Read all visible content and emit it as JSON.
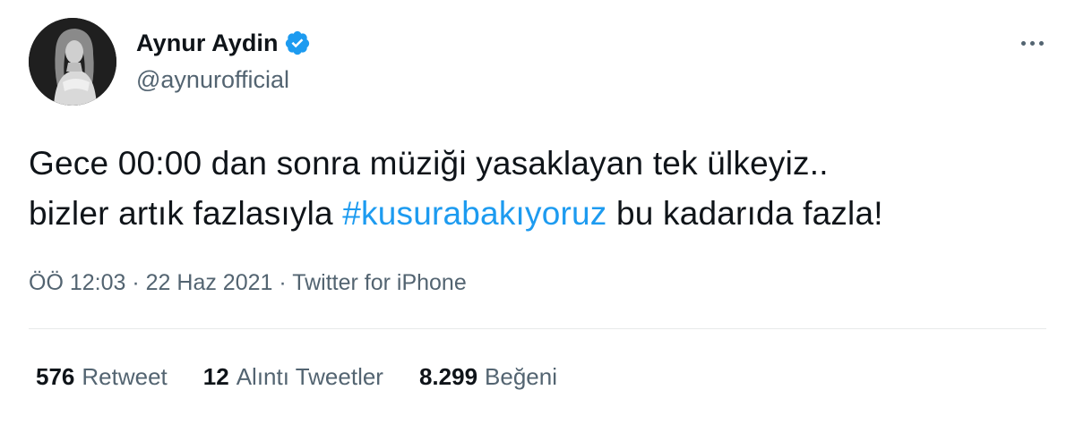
{
  "author": {
    "display_name": "Aynur Aydin",
    "handle": "@aynurofficial",
    "verified_icon": "verified-badge-icon",
    "verified_color": "#1d9bf0"
  },
  "tweet": {
    "line1": "Gece 00:00 dan sonra müziği yasaklayan tek ülkeyiz..",
    "line2_prefix": "bizler artık fazlasıyla ",
    "hashtag": "#kusurabakıyoruz",
    "line2_suffix": " bu kadarıda fazla!",
    "hashtag_color": "#1d9bf0"
  },
  "meta": {
    "time": "ÖÖ 12:03",
    "separator": "·",
    "date": "22 Haz 2021",
    "source": "Twitter for iPhone"
  },
  "stats": {
    "retweets_count": "576",
    "retweets_label": "Retweet",
    "quotes_count": "12",
    "quotes_label": "Alıntı Tweetler",
    "likes_count": "8.299",
    "likes_label": "Beğeni"
  },
  "more_icon": "more-horizontal-icon"
}
